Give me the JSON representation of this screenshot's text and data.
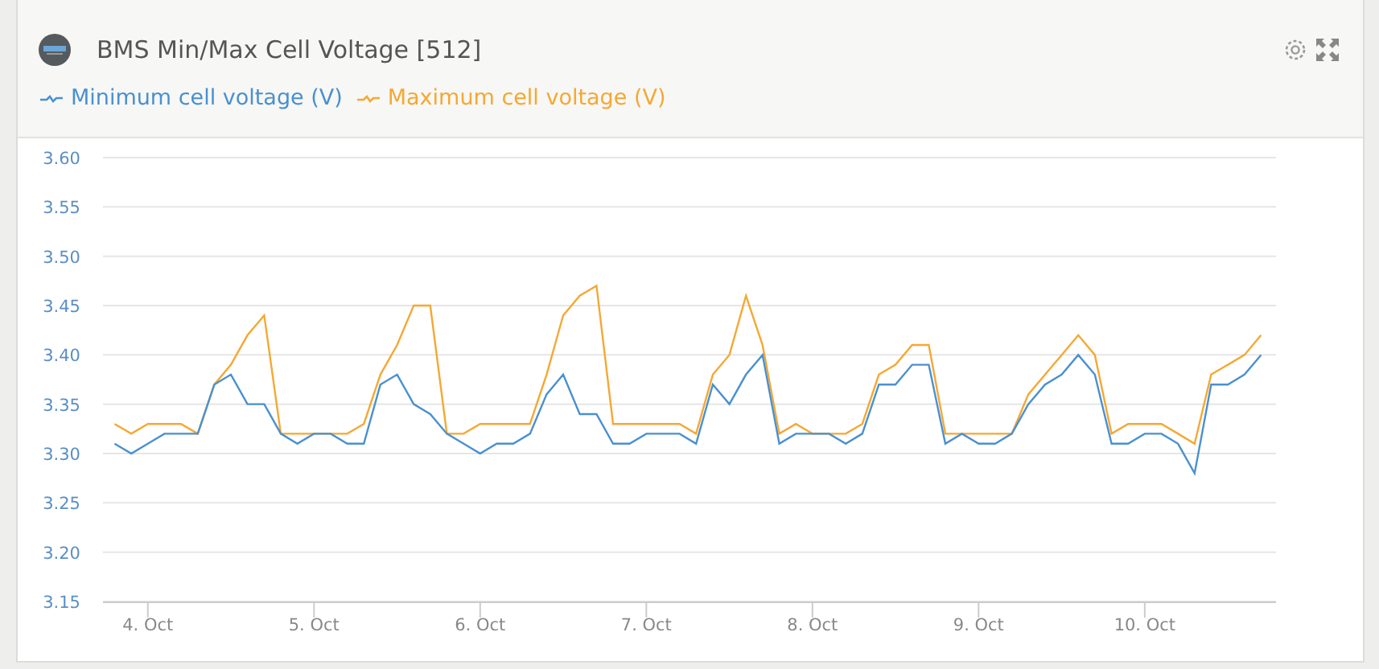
{
  "widget": {
    "title": "BMS Min/Max Cell Voltage [512]",
    "chart_data": {
      "type": "line",
      "grid": true,
      "ylim": [
        3.15,
        3.6
      ],
      "categories": [
        null,
        null,
        "4. Oct",
        null,
        null,
        null,
        null,
        null,
        null,
        null,
        null,
        null,
        "5. Oct",
        null,
        null,
        null,
        null,
        null,
        null,
        null,
        null,
        null,
        "6. Oct",
        null,
        null,
        null,
        null,
        null,
        null,
        null,
        null,
        null,
        "7. Oct",
        null,
        null,
        null,
        null,
        null,
        null,
        null,
        null,
        null,
        "8. Oct",
        null,
        null,
        null,
        null,
        null,
        null,
        null,
        null,
        null,
        "9. Oct",
        null,
        null,
        null,
        null,
        null,
        null,
        null,
        null,
        null,
        "10. Oct",
        null,
        null,
        null,
        null,
        null,
        null,
        null
      ],
      "series": [
        {
          "name": "Minimum cell voltage (V)",
          "color": "#4a90d0",
          "values": [
            3.31,
            3.3,
            3.31,
            3.32,
            3.32,
            3.32,
            3.37,
            3.38,
            3.35,
            3.35,
            3.32,
            3.31,
            3.32,
            3.32,
            3.31,
            3.31,
            3.37,
            3.38,
            3.35,
            3.34,
            3.32,
            3.31,
            3.3,
            3.31,
            3.31,
            3.32,
            3.36,
            3.38,
            3.34,
            3.34,
            3.31,
            3.31,
            3.32,
            3.32,
            3.32,
            3.31,
            3.37,
            3.35,
            3.38,
            3.4,
            3.31,
            3.32,
            3.32,
            3.32,
            3.31,
            3.32,
            3.37,
            3.37,
            3.39,
            3.39,
            3.31,
            3.32,
            3.31,
            3.31,
            3.32,
            3.35,
            3.37,
            3.38,
            3.4,
            3.38,
            3.31,
            3.31,
            3.32,
            3.32,
            3.31,
            3.28,
            3.37,
            3.37,
            3.38,
            3.4
          ]
        },
        {
          "name": "Maximum cell voltage (V)",
          "color": "#f5a833",
          "values": [
            3.33,
            3.32,
            3.33,
            3.33,
            3.33,
            3.32,
            3.37,
            3.39,
            3.42,
            3.44,
            3.32,
            3.32,
            3.32,
            3.32,
            3.32,
            3.33,
            3.38,
            3.41,
            3.45,
            3.45,
            3.32,
            3.32,
            3.33,
            3.33,
            3.33,
            3.33,
            3.38,
            3.44,
            3.46,
            3.47,
            3.33,
            3.33,
            3.33,
            3.33,
            3.33,
            3.32,
            3.38,
            3.4,
            3.46,
            3.41,
            3.32,
            3.33,
            3.32,
            3.32,
            3.32,
            3.33,
            3.38,
            3.39,
            3.41,
            3.41,
            3.32,
            3.32,
            3.32,
            3.32,
            3.32,
            3.36,
            3.38,
            3.4,
            3.42,
            3.4,
            3.32,
            3.33,
            3.33,
            3.33,
            3.32,
            3.31,
            3.38,
            3.39,
            3.4,
            3.42
          ]
        }
      ],
      "yticks": [
        {
          "value": 3.15,
          "label": "3.15"
        },
        {
          "value": 3.2,
          "label": "3.20"
        },
        {
          "value": 3.25,
          "label": "3.25"
        },
        {
          "value": 3.3,
          "label": "3.30"
        },
        {
          "value": 3.35,
          "label": "3.35"
        },
        {
          "value": 3.4,
          "label": "3.40"
        },
        {
          "value": 3.45,
          "label": "3.45"
        },
        {
          "value": 3.5,
          "label": "3.50"
        },
        {
          "value": 3.55,
          "label": "3.55"
        },
        {
          "value": 3.6,
          "label": "3.60"
        }
      ]
    }
  }
}
